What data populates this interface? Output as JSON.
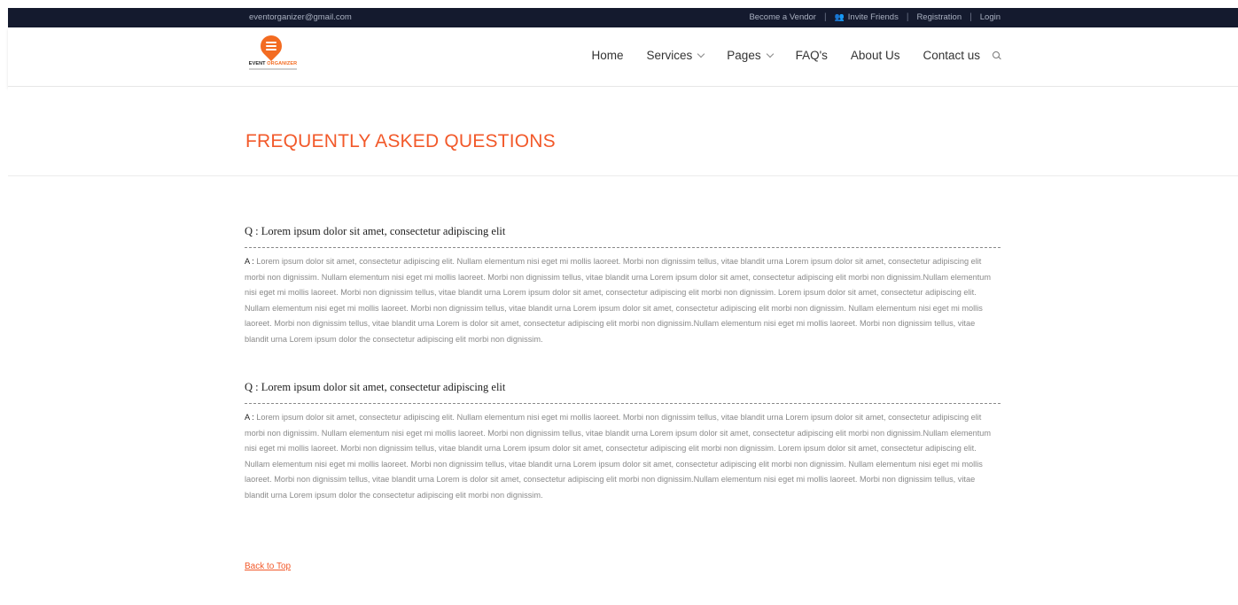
{
  "topbar": {
    "email": "eventorganizer@gmail.com",
    "links": {
      "vendor": "Become a Vendor",
      "invite": "Invite Friends",
      "registration": "Registration",
      "login": "Login"
    },
    "separator": "|",
    "icons": {
      "invite": "user-group-icon"
    }
  },
  "logo": {
    "line1": "EVENT",
    "line2": "ORGANIZER",
    "icon": "map-pin-icon"
  },
  "nav": {
    "items": [
      {
        "label": "Home",
        "has_dropdown": false
      },
      {
        "label": "Services",
        "has_dropdown": true
      },
      {
        "label": "Pages",
        "has_dropdown": true
      },
      {
        "label": "FAQ's",
        "has_dropdown": false
      },
      {
        "label": "About Us",
        "has_dropdown": false
      },
      {
        "label": "Contact us",
        "has_dropdown": false
      }
    ],
    "search_icon": "search-icon"
  },
  "page": {
    "title": "FREQUENTLY ASKED QUESTIONS"
  },
  "faq": [
    {
      "question": "Q : Lorem ipsum dolor sit amet, consectetur adipiscing elit",
      "answer_label": "A :",
      "answer": "Lorem ipsum dolor sit amet, consectetur adipiscing elit. Nullam elementum nisi eget mi mollis laoreet. Morbi non dignissim tellus, vitae blandit urna Lorem ipsum dolor sit amet, consectetur adipiscing elit morbi non dignissim. Nullam elementum nisi eget mi mollis laoreet. Morbi non dignissim tellus, vitae blandit urna Lorem ipsum dolor sit amet, consectetur adipiscing elit morbi non dignissim.Nullam elementum nisi eget mi mollis laoreet. Morbi non dignissim tellus, vitae blandit urna Lorem ipsum dolor sit amet, consectetur adipiscing elit morbi non dignissim. Lorem ipsum dolor sit amet, consectetur adipiscing elit. Nullam elementum nisi eget mi mollis laoreet. Morbi non dignissim tellus, vitae blandit urna Lorem ipsum dolor sit amet, consectetur adipiscing elit morbi non dignissim. Nullam elementum nisi eget mi mollis laoreet. Morbi non dignissim tellus, vitae blandit urna Lorem is dolor sit amet, consectetur adipiscing elit morbi non dignissim.Nullam elementum nisi eget mi mollis laoreet. Morbi non dignissim tellus, vitae blandit urna Lorem ipsum dolor the consectetur adipiscing elit morbi non dignissim."
    },
    {
      "question": "Q : Lorem ipsum dolor sit amet, consectetur adipiscing elit",
      "answer_label": "A :",
      "answer": "Lorem ipsum dolor sit amet, consectetur adipiscing elit. Nullam elementum nisi eget mi mollis laoreet. Morbi non dignissim tellus, vitae blandit urna Lorem ipsum dolor sit amet, consectetur adipiscing elit morbi non dignissim. Nullam elementum nisi eget mi mollis laoreet. Morbi non dignissim tellus, vitae blandit urna Lorem ipsum dolor sit amet, consectetur adipiscing elit morbi non dignissim.Nullam elementum nisi eget mi mollis laoreet. Morbi non dignissim tellus, vitae blandit urna Lorem ipsum dolor sit amet, consectetur adipiscing elit morbi non dignissim. Lorem ipsum dolor sit amet, consectetur adipiscing elit. Nullam elementum nisi eget mi mollis laoreet. Morbi non dignissim tellus, vitae blandit urna Lorem ipsum dolor sit amet, consectetur adipiscing elit morbi non dignissim. Nullam elementum nisi eget mi mollis laoreet. Morbi non dignissim tellus, vitae blandit urna Lorem is dolor sit amet, consectetur adipiscing elit morbi non dignissim.Nullam elementum nisi eget mi mollis laoreet. Morbi non dignissim tellus, vitae blandit urna Lorem ipsum dolor the consectetur adipiscing elit morbi non dignissim."
    }
  ],
  "back_to_top": "Back to Top",
  "colors": {
    "accent": "#f2592a",
    "topbar_bg": "#141a2e",
    "logo_orange": "#f36b21"
  }
}
